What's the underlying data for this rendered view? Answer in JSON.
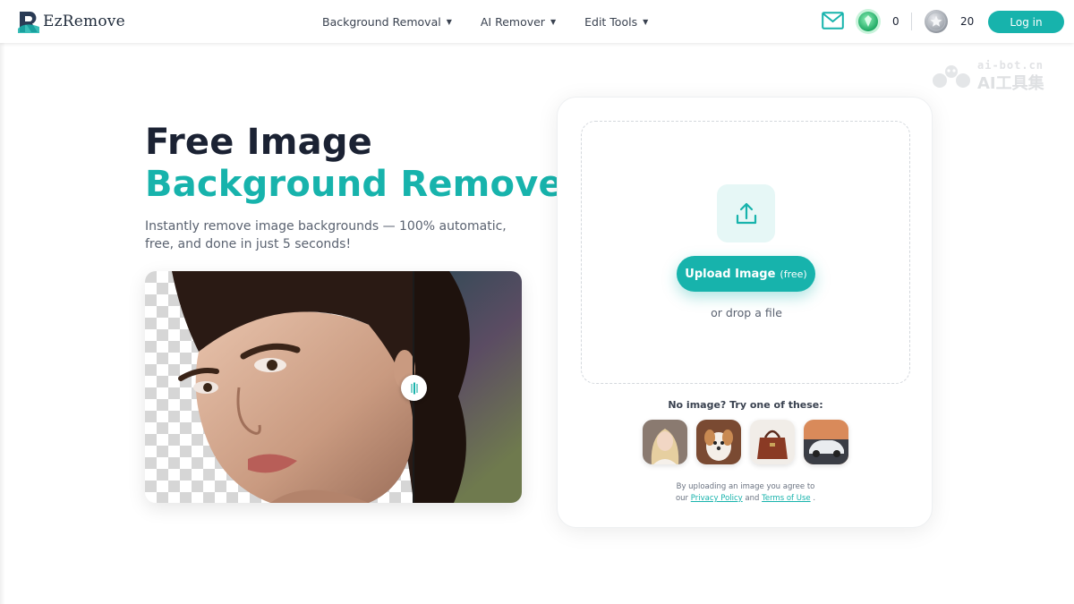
{
  "header": {
    "logo_text": "EzRemove",
    "nav": [
      {
        "label": "Background Removal"
      },
      {
        "label": "AI Remover"
      },
      {
        "label": "Edit Tools"
      }
    ],
    "gem_count": "0",
    "coin_count": "20",
    "login_label": "Log in"
  },
  "watermark": {
    "line1": "ai-bot.cn",
    "line2": "AI工具集"
  },
  "hero": {
    "title_line1": "Free Image",
    "title_line2": "Background Remover",
    "subtitle": "Instantly remove image backgrounds — 100% automatic, free, and done in just 5 seconds!"
  },
  "upload": {
    "button_label": "Upload Image",
    "button_suffix": "(free)",
    "drop_text": "or drop a file",
    "samples_label": "No image? Try one of these:",
    "samples": [
      "woman-portrait",
      "puppy",
      "handbag",
      "car"
    ],
    "terms_prefix": "By uploading an image you agree to",
    "terms_our": "our",
    "privacy_label": "Privacy Policy",
    "terms_and": "and",
    "terms_label": "Terms of Use",
    "terms_end": "."
  },
  "colors": {
    "accent": "#17b3ac",
    "text_dark": "#1b2233",
    "text_muted": "#5a6270"
  }
}
